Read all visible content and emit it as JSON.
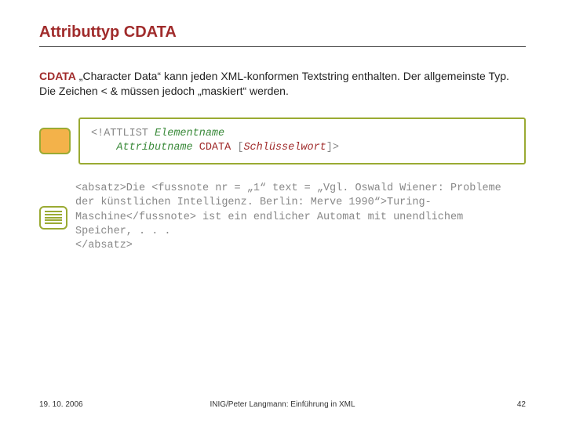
{
  "title": "Attributtyp CDATA",
  "desc": {
    "keyword": "CDATA",
    "text": " „Character Data“ kann jeden XML-konformen Textstring enthalten. Der allgemeinste Typ. Die Zeichen < & müssen jedoch „maskiert“ werden."
  },
  "syntax": {
    "l1a": "<!ATTLIST ",
    "l1b": "Elementname",
    "l2a": "Attributname",
    "l2b": " CDATA ",
    "l2c": "[",
    "l2d": "Schlüsselwort",
    "l2e": "]>"
  },
  "example": {
    "text": "<absatz>Die <fussnote nr = „1“ text = „Vgl. Oswald Wiener: Probleme der künstlichen Intelligenz. Berlin: Merve 1990“>Turing-Maschine</fussnote> ist ein endlicher Automat mit unendlichem Speicher, . . .\n</absatz>"
  },
  "footer": {
    "date": "19. 10. 2006",
    "center": "INIG/Peter Langmann: Einführung in XML",
    "page": "42"
  }
}
